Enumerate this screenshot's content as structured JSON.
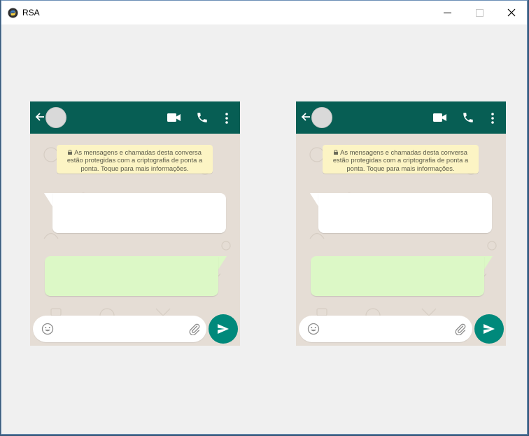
{
  "window": {
    "title": "RSA",
    "icon": "python-icon",
    "controls": [
      "minimize-icon",
      "maximize-icon",
      "close-icon"
    ]
  },
  "colors": {
    "header": "#075e54",
    "chat_background": "#e5ddd5",
    "notice_background": "#fcf4c4",
    "incoming_bubble": "#ffffff",
    "outgoing_bubble": "#dcf8c6",
    "send_button": "#00897b"
  },
  "chats": [
    {
      "header_icons": [
        "back-arrow-icon",
        "avatar",
        "video-call-icon",
        "phone-call-icon",
        "more-options-icon"
      ],
      "notice": "As mensagens e chamadas desta conversa estão protegidas com a criptografia de ponta a ponta. Toque para mais informações.",
      "incoming_message": "",
      "outgoing_message": "",
      "input": {
        "value": "",
        "placeholder": ""
      }
    },
    {
      "header_icons": [
        "back-arrow-icon",
        "avatar",
        "video-call-icon",
        "phone-call-icon",
        "more-options-icon"
      ],
      "notice": "As mensagens e chamadas desta conversa estão protegidas com a criptografia de ponta a ponta. Toque para mais informações.",
      "incoming_message": "",
      "outgoing_message": "",
      "input": {
        "value": "",
        "placeholder": ""
      }
    }
  ]
}
